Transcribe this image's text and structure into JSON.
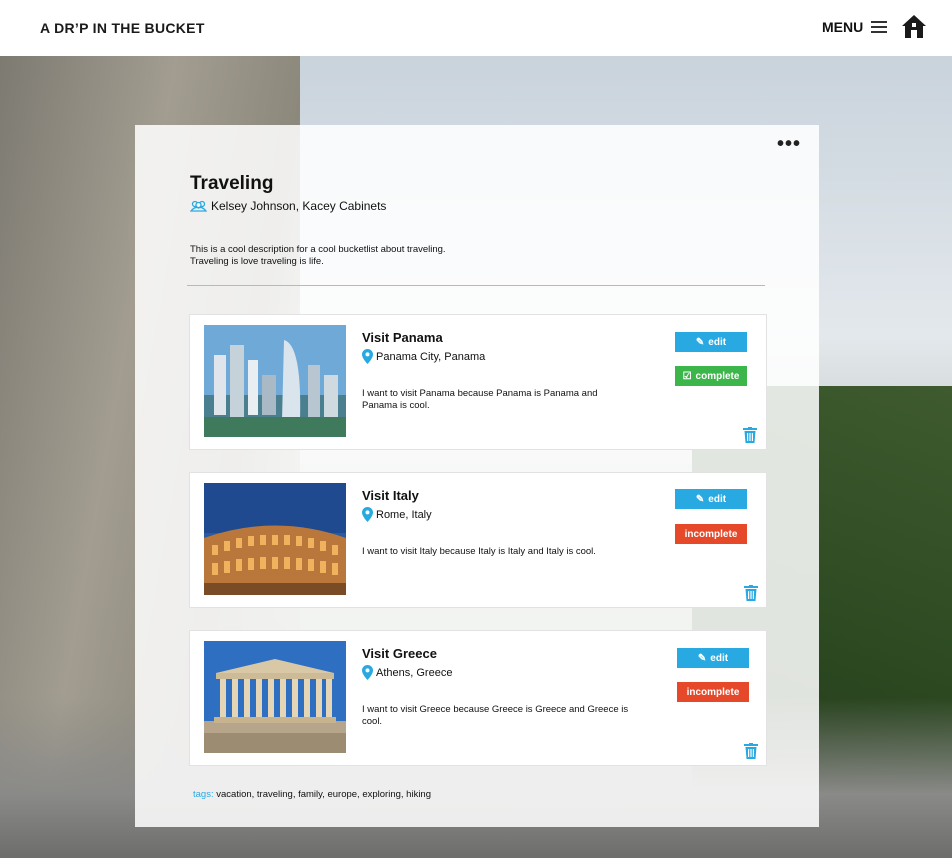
{
  "header": {
    "logo_text": "A DR’P IN THE BUCKET",
    "menu_label": "MENU"
  },
  "list": {
    "title": "Traveling",
    "collaborators": "Kelsey Johnson, Kacey Cabinets",
    "description_line1": "This is a cool description for a cool bucketlist about traveling.",
    "description_line2": "Traveling is love traveling is life."
  },
  "items": [
    {
      "name": "Visit Panama",
      "location": "Panama City, Panama",
      "description": "I want to visit Panama because Panama is Panama and Panama is cool.",
      "edit_label": "edit",
      "status_label": "complete"
    },
    {
      "name": "Visit Italy",
      "location": "Rome, Italy",
      "description": "I want to visit Italy because Italy is Italy and Italy is cool.",
      "edit_label": "edit",
      "status_label": "incomplete"
    },
    {
      "name": "Visit Greece",
      "location": "Athens, Greece",
      "description": "I want to visit Greece because Greece is Greece and Greece is cool.",
      "edit_label": "edit",
      "status_label": "incomplete"
    }
  ],
  "tags": {
    "label": "tags:",
    "values": "vacation, traveling, family, europe, exploring, hiking"
  },
  "colors": {
    "accent_blue": "#29a9e1",
    "complete_green": "#3cb54a",
    "incomplete_red": "#e5492a"
  }
}
